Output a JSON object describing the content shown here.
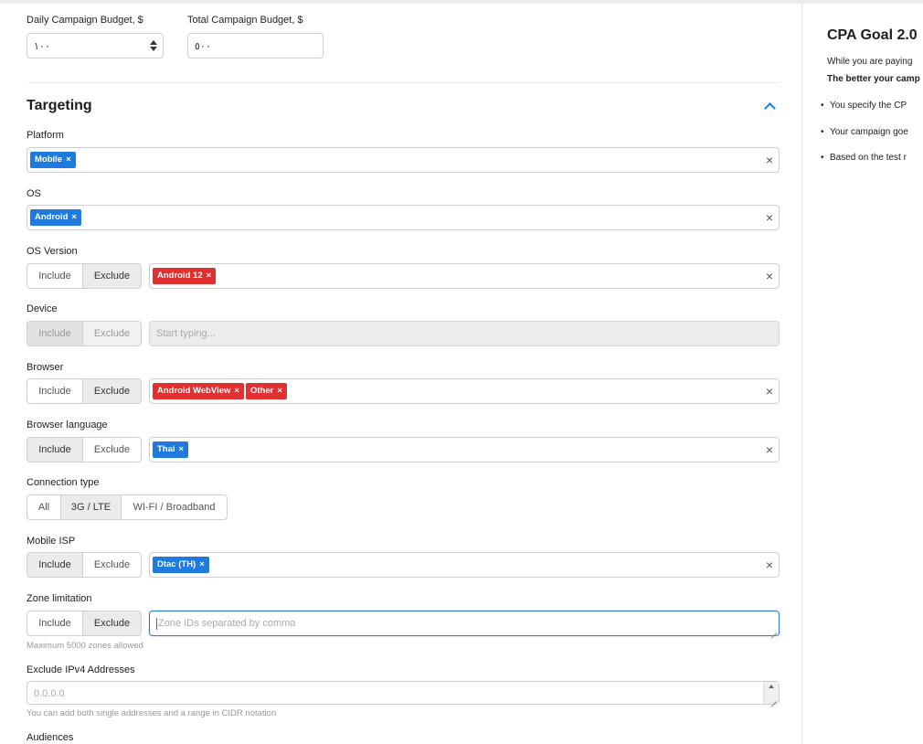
{
  "budget": {
    "daily_label": "Daily Campaign Budget, $",
    "daily_value": "١٠٠",
    "total_label": "Total Campaign Budget, $",
    "total_value": "٥٠٠"
  },
  "targeting": {
    "title": "Targeting",
    "platform": {
      "label": "Platform",
      "tags": [
        "Mobile"
      ]
    },
    "os": {
      "label": "OS",
      "tags": [
        "Android"
      ]
    },
    "os_version": {
      "label": "OS Version",
      "include": "Include",
      "exclude": "Exclude",
      "tags": [
        "Android 12"
      ]
    },
    "device": {
      "label": "Device",
      "include": "Include",
      "exclude": "Exclude",
      "placeholder": "Start typing..."
    },
    "browser": {
      "label": "Browser",
      "include": "Include",
      "exclude": "Exclude",
      "tags": [
        "Android WebView",
        "Other"
      ]
    },
    "browser_language": {
      "label": "Browser language",
      "include": "Include",
      "exclude": "Exclude",
      "tags": [
        "Thai"
      ]
    },
    "connection_type": {
      "label": "Connection type",
      "options": [
        "All",
        "3G / LTE",
        "WI-FI / Broadband"
      ]
    },
    "mobile_isp": {
      "label": "Mobile ISP",
      "include": "Include",
      "exclude": "Exclude",
      "tags": [
        "Dtac (TH)"
      ]
    },
    "zone_limitation": {
      "label": "Zone limitation",
      "include": "Include",
      "exclude": "Exclude",
      "placeholder": "Zone IDs separated by comma",
      "hint": "Maximum 5000 zones allowed"
    },
    "exclude_ipv4": {
      "label": "Exclude IPv4 Addresses",
      "placeholder": "0.0.0.0",
      "hint": "You can add both single addresses and a range in CIDR notation"
    },
    "audiences": {
      "label": "Audiences"
    }
  },
  "sidebar": {
    "title": "CPA Goal 2.0",
    "p1": "While you are paying",
    "p2": "The better your camp",
    "bullets": [
      "You specify the CP",
      "Your campaign goe",
      "Based on the test r"
    ]
  },
  "colors": {
    "accent": "#1f7ae0",
    "danger": "#e03030"
  },
  "icons": {
    "clear": "×",
    "tag_remove": "×"
  }
}
